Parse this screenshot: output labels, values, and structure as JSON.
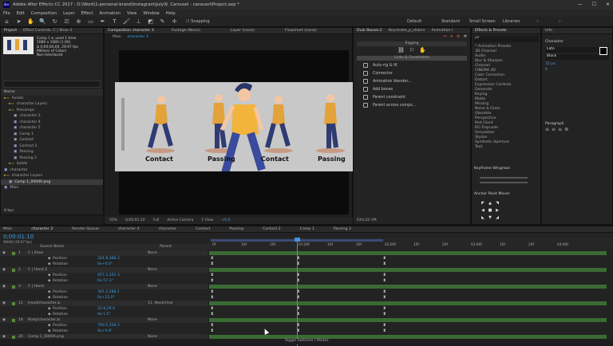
{
  "titlebar": {
    "title": "Adobe After Effects CC 2017 - D:\\Work\\1-personal-brand\\Instagram\\July\\6. Carousel - carousel\\Project.aep *",
    "logo": "Ae",
    "min": "—",
    "max": "☐",
    "close": "✕"
  },
  "menu": [
    "File",
    "Edit",
    "Composition",
    "Layer",
    "Effect",
    "Animation",
    "View",
    "Window",
    "Help"
  ],
  "toolbar": {
    "snapping": "Snapping",
    "workspaces": [
      "Default",
      "Standard",
      "Small Screen",
      "Libraries"
    ]
  },
  "project": {
    "tabs": [
      "Project",
      "Effect Controls: C | Shoe 2"
    ],
    "comp_name": "Comp 1 ▾",
    "used": ", used 1 time",
    "dims": "1080 x 1080 (1.00)",
    "duration": "Δ 0;00;04;00, 29.97 fps",
    "colors": "Millions of Colors",
    "interp": "Non-Interlaced",
    "name_header": "Name",
    "items": [
      {
        "name": "Assets",
        "indent": 0,
        "folder": true
      },
      {
        "name": "character Layers",
        "indent": 1,
        "folder": true
      },
      {
        "name": "Precomps",
        "indent": 1,
        "folder": true
      },
      {
        "name": "character 3",
        "indent": 2,
        "folder": false
      },
      {
        "name": "character 4",
        "indent": 2,
        "folder": false
      },
      {
        "name": "character 5",
        "indent": 2,
        "folder": false
      },
      {
        "name": "Comp 1",
        "indent": 2,
        "folder": false
      },
      {
        "name": "Contact",
        "indent": 2,
        "folder": false
      },
      {
        "name": "Contact 2",
        "indent": 2,
        "folder": false
      },
      {
        "name": "Passing",
        "indent": 2,
        "folder": false
      },
      {
        "name": "Passing 2",
        "indent": 2,
        "folder": false
      },
      {
        "name": "Solids",
        "indent": 1,
        "folder": true
      },
      {
        "name": "character",
        "indent": 0,
        "folder": false
      },
      {
        "name": "character Layers",
        "indent": 0,
        "folder": true
      },
      {
        "name": "Comp 1_00000.png",
        "indent": 1,
        "folder": false,
        "selected": true
      },
      {
        "name": "Main",
        "indent": 0,
        "folder": false
      }
    ],
    "footer": "8 bpc"
  },
  "viewer": {
    "tabs": [
      "Composition character 3",
      "Footage (None)",
      "Layer (none)",
      "Flowchart (none)"
    ],
    "subtabs": [
      "Main",
      "character 3"
    ],
    "labels": [
      "Contact",
      "Passing",
      "Contact",
      "Passing"
    ],
    "zoom": "50%",
    "timecode": "0;00;01;10",
    "res": "Full",
    "camera": "Active Camera",
    "view": "1 View",
    "offset": "+0.0"
  },
  "duik": {
    "tabs": [
      "Duik Bassel.2",
      "Keystroke_p_sliders",
      "Animation I"
    ],
    "section": "Rigging",
    "links": "Links & Constraints",
    "actions": [
      "Auto-rig & IK",
      "Connector",
      "Animation blender...",
      "Add bones",
      "Parent constraint",
      "Parent across comps..."
    ],
    "footer": "RX4.20 VM"
  },
  "effects": {
    "title": "Effects & Presets",
    "search": "ρ▾",
    "items": [
      "* Animation Presets",
      "3D Channel",
      "Audio",
      "Blur & Sharpen",
      "Channel",
      "CINEMA 4D",
      "Color Correction",
      "Distort",
      "Expression Controls",
      "Generate",
      "Keying",
      "Matte",
      "Missing",
      "Noise & Grain",
      "Obsolete",
      "Perspective",
      "Red Giant",
      "RG Trapcode",
      "Simulation",
      "Stylize",
      "Synthetic Aperture",
      "Text"
    ],
    "keyframe_wingman": "Keyframe Wingman",
    "anchor_mover": "Anchor Point Mover"
  },
  "character": {
    "title": "Character",
    "font": "Lato",
    "style": "Black",
    "size": "72 px",
    "tracking": "0",
    "paragraph": "Paragraph",
    "info": "Info"
  },
  "timeline": {
    "tabs": [
      "Main",
      "character 3",
      "Render Queue",
      "character 4",
      "character",
      "Contact",
      "Passing",
      "Contact 2",
      "Comp 1",
      "Passing 2"
    ],
    "timecode": "0;00:01:10",
    "fps": "00040 (29.97 fps)",
    "col_source": "Source Name",
    "col_parent": "Parent",
    "ruler": [
      "0f",
      "10f",
      "20f",
      "01:00f",
      "10f",
      "20f",
      "02:00f",
      "10f",
      "20f",
      "03:00f",
      "10f",
      "20f",
      "04:00f"
    ],
    "layers": [
      {
        "num": "1",
        "name": "C | Shoe",
        "parent": "None",
        "type": "layer"
      },
      {
        "num": "",
        "name": "Position",
        "value": "324.8,388.3",
        "type": "prop"
      },
      {
        "num": "",
        "name": "Rotation",
        "value": "0x+0.0°",
        "type": "prop"
      },
      {
        "num": "2",
        "name": "C | Hand 2",
        "parent": "None",
        "type": "layer"
      },
      {
        "num": "",
        "name": "Position",
        "value": "457.2,292.3",
        "type": "prop"
      },
      {
        "num": "",
        "name": "Rotation",
        "value": "0x-57.3°",
        "type": "prop"
      },
      {
        "num": "3",
        "name": "C | Hand",
        "parent": "None",
        "type": "layer"
      },
      {
        "num": "",
        "name": "Position",
        "value": "381.2,288.1",
        "type": "prop"
      },
      {
        "num": "",
        "name": "Rotation",
        "value": "0x+12.0°",
        "type": "prop"
      },
      {
        "num": "11",
        "name": "Head/character.ai",
        "parent": "11. Neck/char",
        "type": "layer"
      },
      {
        "num": "",
        "name": "Position",
        "value": "32.8,29.4",
        "type": "prop"
      },
      {
        "num": "",
        "name": "Rotation",
        "value": "0x-1.5°",
        "type": "prop"
      },
      {
        "num": "18",
        "name": "Body/character.ai",
        "parent": "None",
        "type": "layer"
      },
      {
        "num": "",
        "name": "Position",
        "value": "790.5,358.3",
        "type": "prop"
      },
      {
        "num": "",
        "name": "Rotation",
        "value": "0x+0.8°",
        "type": "prop"
      },
      {
        "num": "20",
        "name": "Comp 1_00000.png",
        "parent": "None",
        "type": "layer"
      }
    ],
    "footer": "Toggle Switches / Modes",
    "none": "None",
    "controller": "Controller"
  }
}
